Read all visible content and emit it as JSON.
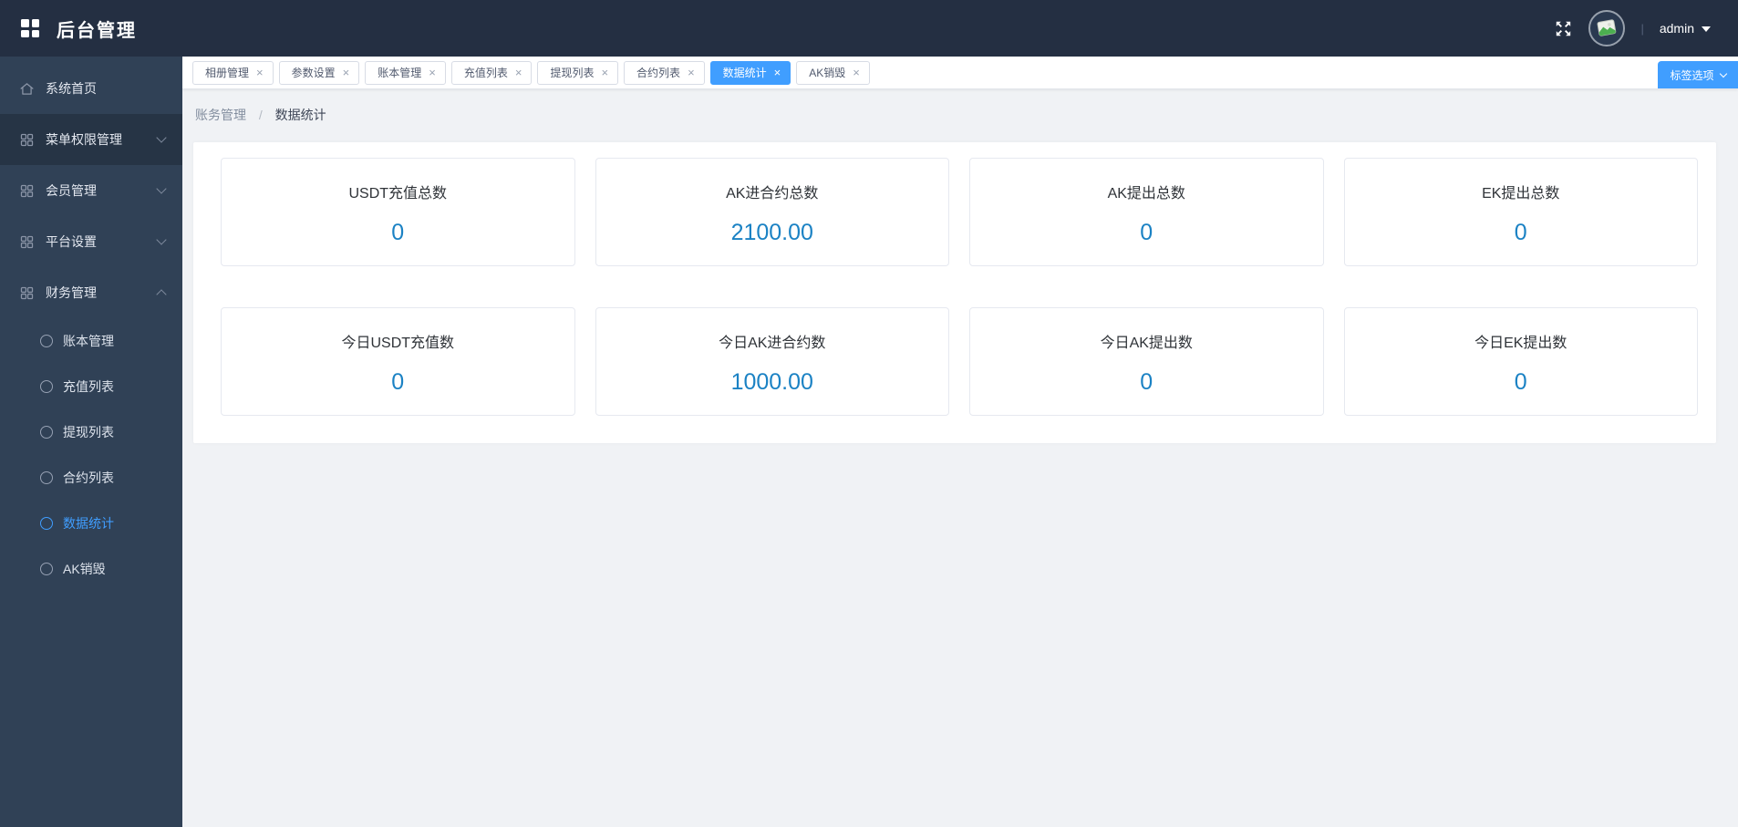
{
  "header": {
    "title": "后台管理",
    "divider": "|",
    "user": "admin",
    "icons": {
      "logo": "grid-logo-icon",
      "fullscreen": "fullscreen-icon",
      "avatar": "avatar-image-placeholder",
      "caret": "caret-down-icon"
    }
  },
  "sidebar": {
    "items": [
      {
        "label": "系统首页",
        "icon": "home-icon"
      },
      {
        "label": "菜单权限管理",
        "icon": "grid-icon",
        "chevron": "down"
      },
      {
        "label": "会员管理",
        "icon": "grid-icon",
        "chevron": "down"
      },
      {
        "label": "平台设置",
        "icon": "grid-icon",
        "chevron": "down"
      },
      {
        "label": "财务管理",
        "icon": "grid-icon",
        "chevron": "up",
        "expanded": true
      }
    ],
    "subitems": [
      {
        "label": "账本管理",
        "active": false
      },
      {
        "label": "充值列表",
        "active": false
      },
      {
        "label": "提现列表",
        "active": false
      },
      {
        "label": "合约列表",
        "active": false
      },
      {
        "label": "数据统计",
        "active": true
      },
      {
        "label": "AK销毁",
        "active": false
      }
    ]
  },
  "tabbar": {
    "close_glyph": "×",
    "options_button": "标签选项",
    "tabs": [
      {
        "label": "相册管理",
        "active": false
      },
      {
        "label": "参数设置",
        "active": false
      },
      {
        "label": "账本管理",
        "active": false
      },
      {
        "label": "充值列表",
        "active": false
      },
      {
        "label": "提现列表",
        "active": false
      },
      {
        "label": "合约列表",
        "active": false
      },
      {
        "label": "数据统计",
        "active": true
      },
      {
        "label": "AK销毁",
        "active": false
      }
    ]
  },
  "breadcrumb": {
    "parent": "账务管理",
    "separator": "/",
    "current": "数据统计"
  },
  "stats": {
    "cards": [
      {
        "title": "USDT充值总数",
        "value": "0"
      },
      {
        "title": "AK进合约总数",
        "value": "2100.00"
      },
      {
        "title": "AK提出总数",
        "value": "0"
      },
      {
        "title": "EK提出总数",
        "value": "0"
      },
      {
        "title": "今日USDT充值数",
        "value": "0"
      },
      {
        "title": "今日AK进合约数",
        "value": "1000.00"
      },
      {
        "title": "今日AK提出数",
        "value": "0"
      },
      {
        "title": "今日EK提出数",
        "value": "0"
      }
    ]
  },
  "colors": {
    "accent": "#409eff",
    "header_bg": "#242f42",
    "sidebar_bg": "#304156",
    "sidebar_item_dark_bg": "#263445",
    "stat_value_blue": "#1b82c4",
    "content_bg": "#f0f2f5"
  }
}
